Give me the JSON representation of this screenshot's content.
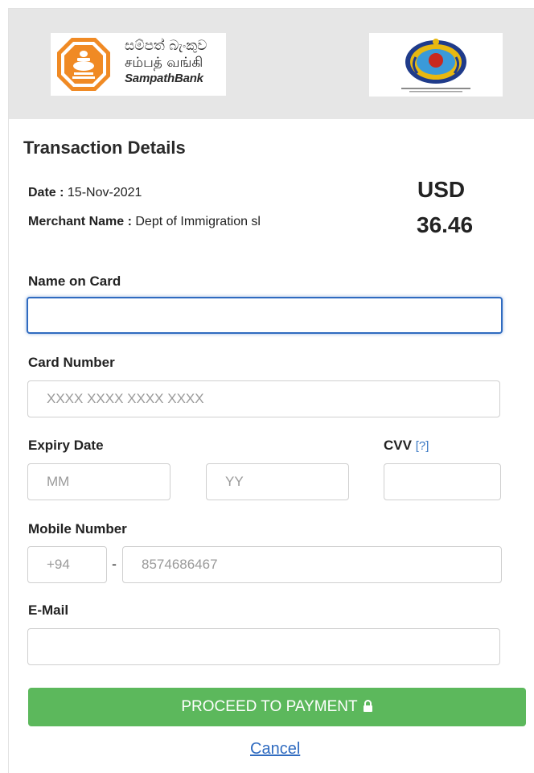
{
  "header": {
    "bank_name_sinhala": "සම්පත් බැංකුව",
    "bank_name_tamil": "சம்பத் வங்கி",
    "bank_name_english": "SampathBank"
  },
  "transaction": {
    "title": "Transaction Details",
    "date_label": "Date :",
    "date_value": "15-Nov-2021",
    "merchant_label": "Merchant Name :",
    "merchant_value": "Dept of Immigration sl",
    "currency": "USD",
    "amount": "36.46"
  },
  "form": {
    "name_label": "Name on Card",
    "name_value": "",
    "card_label": "Card Number",
    "card_placeholder": "XXXX XXXX XXXX XXXX",
    "expiry_label": "Expiry Date",
    "month_placeholder": "MM",
    "year_placeholder": "YY",
    "cvv_label": "CVV",
    "cvv_help": "[?]",
    "mobile_label": "Mobile Number",
    "country_code_placeholder": "+94",
    "dash": "-",
    "mobile_placeholder": "8574686467",
    "email_label": "E-Mail"
  },
  "actions": {
    "proceed_label": "PROCEED TO PAYMENT",
    "cancel_label": "Cancel"
  },
  "colors": {
    "header_bg": "#e6e6e6",
    "proceed_bg": "#5cb85c",
    "link": "#2f6bc0",
    "focus_border": "#2f6bc0",
    "bank_orange": "#f08a24"
  },
  "icons": {
    "bank_emblem": "sampath-bank-emblem-icon",
    "gov_emblem": "immigration-emblem-icon",
    "lock": "lock-icon"
  }
}
